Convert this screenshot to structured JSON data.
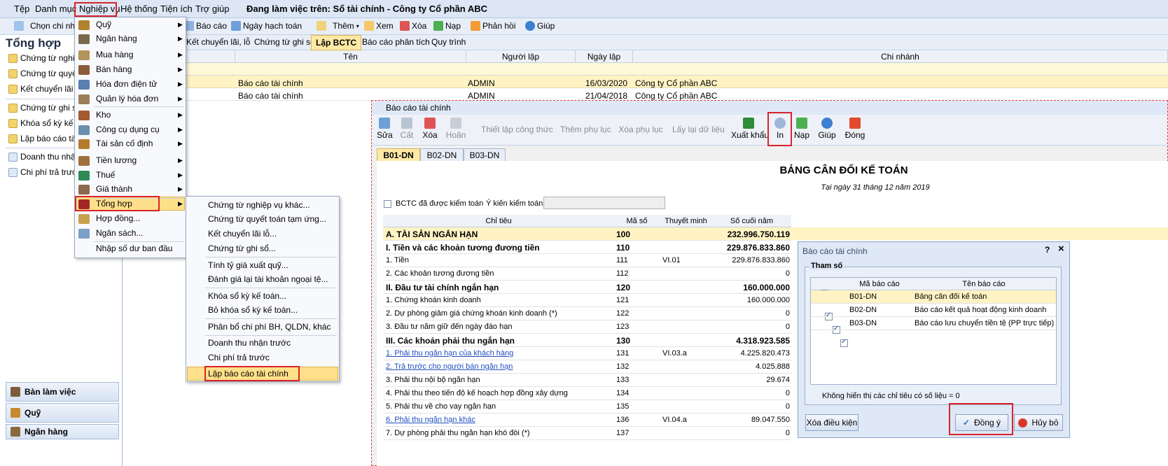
{
  "menubar": {
    "items": [
      "Tệp",
      "Danh mục",
      "Nghiệp vụ",
      "Hệ thống",
      "Tiện ích",
      "Trợ giúp"
    ],
    "working_on": "Đang làm việc trên: Sổ tài chính - Công ty Cổ phần ABC"
  },
  "toolbar": {
    "branch_label": "Chọn chi nh",
    "report_label": "Báo cáo",
    "accounting_date_label": "Ngày hạch toán",
    "add_label": "Thêm",
    "view_label": "Xem",
    "delete_label": "Xóa",
    "reload_label": "Nạp",
    "feedback_label": "Phản hồi",
    "help_label": "Giúp"
  },
  "main_tabs": [
    "Kết chuyển lãi, lỗ",
    "Chứng từ ghi sổ",
    "Lập BCTC",
    "Báo cáo phân tích",
    "Quy trình"
  ],
  "left_panel": {
    "title": "Tổng hợp",
    "items": [
      "Chứng từ nghiệp",
      "Chứng từ quyết",
      "Kết chuyển lãi lỗ",
      "Chứng từ ghi sổ",
      "Khóa sổ kỳ kế t",
      "Lập báo cáo tài",
      "Doanh thu nhận",
      "Chi phí trả trước"
    ],
    "bottom": [
      "Bàn làm việc",
      "Quỹ",
      "Ngân hàng"
    ]
  },
  "grid": {
    "columns": [
      "ão",
      "Tên",
      "Người lập",
      "Ngày lập",
      "Chi nhánh"
    ],
    "rows": [
      {
        "name": "Báo cáo tài chính",
        "creator": "ADMIN",
        "date": "16/03/2020",
        "branch": "Công ty Cổ phần ABC"
      },
      {
        "name": "Báo cáo tài chính",
        "creator": "ADMIN",
        "date": "21/04/2018",
        "branch": "Công ty Cổ phần ABC"
      }
    ]
  },
  "menu_nghiep_vu": {
    "items": [
      "Quỹ",
      "Ngân hàng",
      "Mua hàng",
      "Bán hàng",
      "Hóa đơn điện tử",
      "Quản lý hóa đơn",
      "Kho",
      "Công cụ dụng cụ",
      "Tài sản cố định",
      "Tiền lương",
      "Thuế",
      "Giá thành",
      "Tổng hợp",
      "Hợp đồng...",
      "Ngân sách...",
      "Nhập số dư ban đầu"
    ]
  },
  "menu_tong_hop": {
    "items": [
      "Chứng từ nghiệp vụ khác...",
      "Chứng từ quyết toán tạm ứng...",
      "Kết chuyển lãi lỗ...",
      "Chứng từ ghi sổ...",
      "Tính tỷ giá xuất quỹ...",
      "Đánh giá lại tài khoản ngoại tệ...",
      "Khóa sổ kỳ kế toán...",
      "Bỏ khóa sổ kỳ kế toán...",
      "Phân bổ chi phí BH, QLDN, khác",
      "Doanh thu nhận trước",
      "Chi phí trả trước",
      "Lập báo cáo tài chính"
    ]
  },
  "report_window": {
    "title": "Báo cáo tài chính",
    "toolbar": {
      "edit": "Sửa",
      "cut": "Cất",
      "delete": "Xóa",
      "undo": "Hoãn",
      "setup_formula": "Thiết lập công thức",
      "add_appendix": "Thêm phụ lục",
      "remove_appendix": "Xóa phụ lục",
      "reload_data": "Lấy lại dữ liệu",
      "export": "Xuất khẩu",
      "print": "In",
      "reload": "Nạp",
      "help": "Giúp",
      "close": "Đóng"
    },
    "tabs": [
      "B01-DN",
      "B02-DN",
      "B03-DN"
    ],
    "heading": "BẢNG CÂN ĐỐI KẾ TOÁN",
    "date_line": "Tại ngày 31 tháng 12 năm 2019",
    "audited_label": "BCTC đã được kiểm toán",
    "audit_opinion_label": "Ý kiến kiểm toán",
    "columns": [
      "Chỉ tiêu",
      "Mã số",
      "Thuyết minh",
      "Số cuối năm"
    ],
    "rows": [
      {
        "name": "A. TÀI SẢN NGẮN HẠN",
        "code": "100",
        "note": "",
        "value": "232.996.750.119",
        "style": "bold-hl"
      },
      {
        "name": "I. Tiền và các khoản tương đương tiền",
        "code": "110",
        "note": "",
        "value": "229.876.833.860",
        "style": "bold"
      },
      {
        "name": "1. Tiền",
        "code": "111",
        "note": "VI.01",
        "value": "229.876.833.860",
        "style": ""
      },
      {
        "name": "2. Các khoản tương đương tiền",
        "code": "112",
        "note": "",
        "value": "0",
        "style": ""
      },
      {
        "name": "II. Đầu tư tài chính ngắn hạn",
        "code": "120",
        "note": "",
        "value": "160.000.000",
        "style": "bold"
      },
      {
        "name": "1. Chứng khoán kinh doanh",
        "code": "121",
        "note": "",
        "value": "160.000.000",
        "style": ""
      },
      {
        "name": "2. Dự phòng giảm giá chứng khoán kinh doanh (*)",
        "code": "122",
        "note": "",
        "value": "0",
        "style": ""
      },
      {
        "name": "3. Đầu tư nắm giữ đến ngày đáo hạn",
        "code": "123",
        "note": "",
        "value": "0",
        "style": ""
      },
      {
        "name": "III. Các khoản phải thu ngắn hạn",
        "code": "130",
        "note": "",
        "value": "4.318.923.585",
        "style": "bold"
      },
      {
        "name": "1. Phải thu ngắn hạn của khách hàng",
        "code": "131",
        "note": "VI.03.a",
        "value": "4.225.820.473",
        "style": "link"
      },
      {
        "name": "2. Trả trước cho người bán ngắn hạn",
        "code": "132",
        "note": "",
        "value": "4.025.888",
        "style": "link"
      },
      {
        "name": "3. Phải thu nội bộ ngắn hạn",
        "code": "133",
        "note": "",
        "value": "29.674",
        "style": ""
      },
      {
        "name": "4. Phải thu theo tiến độ kế hoạch hợp đồng xây dựng",
        "code": "134",
        "note": "",
        "value": "0",
        "style": ""
      },
      {
        "name": "5. Phải thu về cho vay ngắn hạn",
        "code": "135",
        "note": "",
        "value": "0",
        "style": ""
      },
      {
        "name": "6. Phải thu ngắn hạn khác",
        "code": "136",
        "note": "VI.04.a",
        "value": "89.047.550",
        "style": "link"
      },
      {
        "name": "7. Dự phòng phải thu ngắn hạn khó đòi (*)",
        "code": "137",
        "note": "",
        "value": "0",
        "style": ""
      }
    ]
  },
  "dialog": {
    "title": "Báo cáo tài chính",
    "help_mark": "?",
    "close_mark": "×",
    "group_label": "Tham số",
    "columns": [
      "Mã báo cáo",
      "Tên báo cáo"
    ],
    "rows": [
      {
        "code": "B01-DN",
        "name": "Bảng cân đối kế toán"
      },
      {
        "code": "B02-DN",
        "name": "Báo cáo kết quả hoạt động kinh doanh"
      },
      {
        "code": "B03-DN",
        "name": "Báo cáo lưu chuyển tiền tệ (PP trực tiếp)"
      }
    ],
    "hide_zero_label": "Không hiển thị các chỉ tiêu có số liệu = 0",
    "clear_btn": "Xóa điều kiện",
    "ok_btn": "Đồng ý",
    "cancel_btn": "Hủy bỏ"
  }
}
